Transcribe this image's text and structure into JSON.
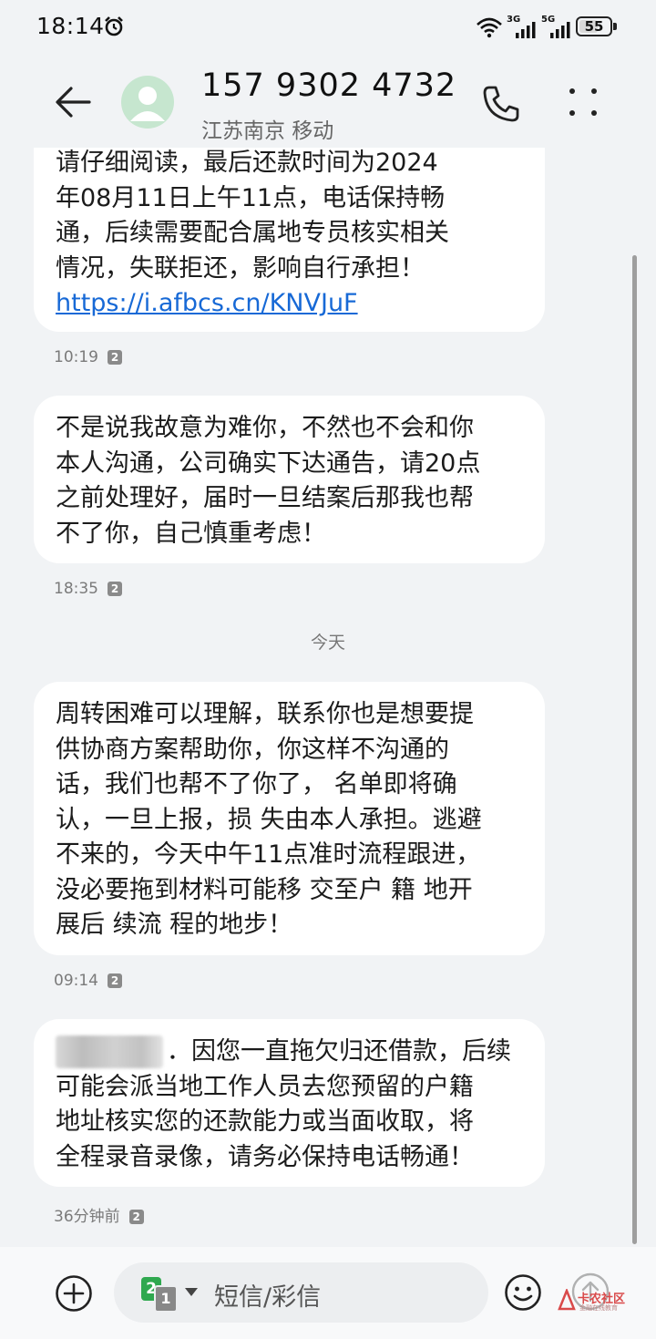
{
  "status_bar": {
    "time": "18:14",
    "signal1_label": "3G",
    "signal2_label": "5G",
    "battery_level": "55"
  },
  "header": {
    "contact_name": "157 9302 4732",
    "contact_sub": "江苏南京 移动"
  },
  "messages": [
    {
      "text": "请仔细阅读，最后还款时间为2024\n年08月11日上午11点，电话保持畅\n通，后续需要配合属地专员核实相关\n情况，失联拒还，影响自行承担！",
      "link": "https://i.afbcs.cn/KNVJuF",
      "time": "10:19",
      "sim": "2"
    },
    {
      "text": "不是说我故意为难你，不然也不会和你\n本人沟通，公司确实下达通告，请20点\n之前处理好，届时一旦结案后那我也帮\n不了你，自己慎重考虑！",
      "time": "18:35",
      "sim": "2"
    },
    {
      "text": "周转困难可以理解，联系你也是想要提\n供协商方案帮助你，你这样不沟通的\n话，我们也帮不了你了， 名单即将确\n认，一旦上报，损 失由本人承担。逃避\n不来的，今天中午11点准时流程跟进，\n没必要拖到材料可能移 交至户 籍 地开\n展后 续流 程的地步！",
      "time": "09:14",
      "sim": "2"
    },
    {
      "text_first": "．因您一直拖欠归还借款，后续",
      "text": "可能会派当地工作人员去您预留的户籍\n地址核实您的还款能力或当面收取，将\n全程录音录像，请务必保持电话畅通！",
      "time": "36分钟前",
      "sim": "2"
    }
  ],
  "date_separator": "今天",
  "composer": {
    "placeholder": "短信/彩信",
    "sim_primary": "2",
    "sim_secondary": "1"
  },
  "watermark": {
    "text": "卡农社区",
    "sub": "金融在线教育"
  },
  "colors": {
    "background": "#f1f3f5",
    "bubble": "#ffffff",
    "link": "#1769d6",
    "avatar": "#c6e6cf",
    "sim_active": "#2fa84f"
  }
}
